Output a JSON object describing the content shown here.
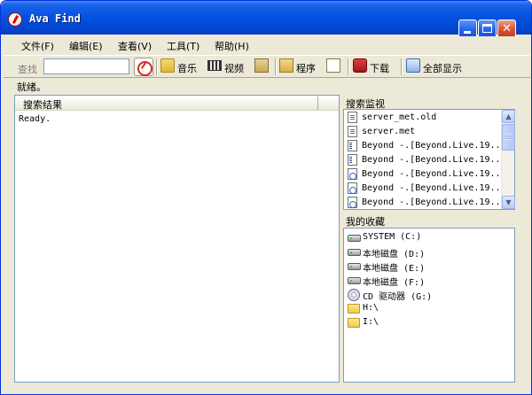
{
  "window": {
    "title": "Ava Find"
  },
  "menubar": {
    "items": [
      {
        "label": "文件(F)"
      },
      {
        "label": "编辑(E)"
      },
      {
        "label": "查看(V)"
      },
      {
        "label": "工具(T)"
      },
      {
        "label": "帮助(H)"
      }
    ]
  },
  "toolbar": {
    "search_label": "查找",
    "search_value": "",
    "buttons": [
      {
        "label": "音乐",
        "icon": "music-folder-icon"
      },
      {
        "label": "视频",
        "icon": "film-icon"
      },
      {
        "label": "",
        "icon": "archive-icon"
      },
      {
        "label": "程序",
        "icon": "program-folder-icon"
      },
      {
        "label": "",
        "icon": "document-icon"
      },
      {
        "label": "下载",
        "icon": "download-icon"
      },
      {
        "label": "全部显示",
        "icon": "show-all-icon"
      }
    ]
  },
  "status": {
    "text": "就绪。"
  },
  "results": {
    "header": "搜索结果",
    "text": "Ready."
  },
  "monitor": {
    "title": "搜索监视",
    "items": [
      {
        "name": "server_met.old",
        "icon": "document-icon"
      },
      {
        "name": "server.met",
        "icon": "document-icon"
      },
      {
        "name": "Beyond -.[Beyond.Live.19...",
        "icon": "media-file-icon"
      },
      {
        "name": "Beyond -.[Beyond.Live.19...",
        "icon": "media-file-icon"
      },
      {
        "name": "Beyond -.[Beyond.Live.19...",
        "icon": "audio-file-icon"
      },
      {
        "name": "Beyond -.[Beyond.Live.19...",
        "icon": "audio-file-icon"
      },
      {
        "name": "Beyond -.[Beyond.Live.19...",
        "icon": "audio-file-icon"
      }
    ]
  },
  "favorites": {
    "title": "我的收藏",
    "items": [
      {
        "name": "SYSTEM (C:)",
        "icon": "hard-drive-icon"
      },
      {
        "name": "本地磁盘 (D:)",
        "icon": "hard-drive-icon"
      },
      {
        "name": "本地磁盘 (E:)",
        "icon": "hard-drive-icon"
      },
      {
        "name": "本地磁盘 (F:)",
        "icon": "hard-drive-icon"
      },
      {
        "name": "CD 驱动器 (G:)",
        "icon": "cd-drive-icon"
      },
      {
        "name": "H:\\",
        "icon": "folder-icon"
      },
      {
        "name": "I:\\",
        "icon": "folder-icon"
      }
    ]
  }
}
